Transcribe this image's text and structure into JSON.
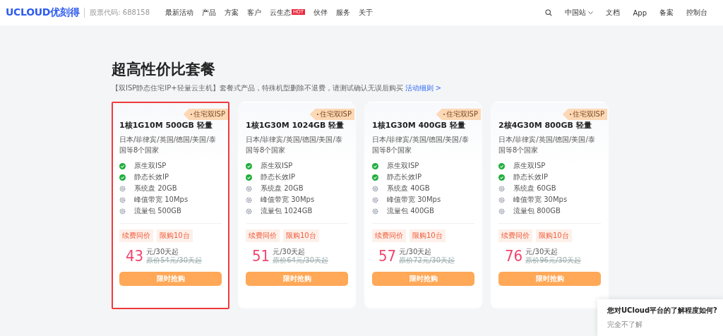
{
  "header": {
    "logo": "UCLOUD优刻得",
    "stock_code": "股票代码: 688158",
    "nav": [
      {
        "label": "最新活动"
      },
      {
        "label": "产品"
      },
      {
        "label": "方案"
      },
      {
        "label": "客户"
      },
      {
        "label": "云生态",
        "badge": "HOT"
      },
      {
        "label": "伙伴"
      },
      {
        "label": "服务"
      },
      {
        "label": "关于"
      }
    ],
    "region": "中国站",
    "links": [
      "文档",
      "App",
      "备案",
      "控制台"
    ]
  },
  "section": {
    "title": "超高性价比套餐",
    "subtitle": "【双ISP静态住宅IP+轻量云主机】套餐式产品，特殊机型删除不退费，请测试确认无误后购买",
    "link": "活动细则 >"
  },
  "plans": [
    {
      "selected": true,
      "badge": "住宅双ISP",
      "title": "1核1G10M 500GB 轻量",
      "description": "日本/菲律宾/英国/德国/美国/泰国等8个国家",
      "features": [
        {
          "kind": "check",
          "text": "原生双ISP"
        },
        {
          "kind": "check",
          "text": "静态长效IP"
        },
        {
          "kind": "gear",
          "text": "系统盘 20GB"
        },
        {
          "kind": "gear",
          "text": "峰值带宽 10Mps"
        },
        {
          "kind": "gear",
          "text": "流量包 500GB"
        }
      ],
      "tags": [
        "续费同价",
        "限购10台"
      ],
      "price": "43",
      "unit": "元/30天起",
      "original": "原价54元/30天起",
      "button": "限时抢购"
    },
    {
      "selected": false,
      "badge": "住宅双ISP",
      "title": "1核1G30M 1024GB 轻量",
      "description": "日本/菲律宾/英国/德国/美国/泰国等8个国家",
      "features": [
        {
          "kind": "check",
          "text": "原生双ISP"
        },
        {
          "kind": "check",
          "text": "静态长效IP"
        },
        {
          "kind": "gear",
          "text": "系统盘 20GB"
        },
        {
          "kind": "gear",
          "text": "峰值带宽 30Mps"
        },
        {
          "kind": "gear",
          "text": "流量包 1024GB"
        }
      ],
      "tags": [
        "续费同价",
        "限购10台"
      ],
      "price": "51",
      "unit": "元/30天起",
      "original": "原价64元/30天起",
      "button": "限时抢购"
    },
    {
      "selected": false,
      "badge": "住宅双ISP",
      "title": "1核1G30M 400GB 轻量",
      "description": "日本/菲律宾/英国/德国/美国/泰国等8个国家",
      "features": [
        {
          "kind": "check",
          "text": "原生双ISP"
        },
        {
          "kind": "check",
          "text": "静态长效IP"
        },
        {
          "kind": "gear",
          "text": "系统盘 40GB"
        },
        {
          "kind": "gear",
          "text": "峰值带宽 30Mps"
        },
        {
          "kind": "gear",
          "text": "流量包 400GB"
        }
      ],
      "tags": [
        "续费同价",
        "限购10台"
      ],
      "price": "57",
      "unit": "元/30天起",
      "original": "原价72元/30天起",
      "button": "限时抢购"
    },
    {
      "selected": false,
      "badge": "住宅双ISP",
      "title": "2核4G30M 800GB 轻量",
      "description": "日本/菲律宾/英国/德国/美国/泰国等8个国家",
      "features": [
        {
          "kind": "check",
          "text": "原生双ISP"
        },
        {
          "kind": "check",
          "text": "静态长效IP"
        },
        {
          "kind": "gear",
          "text": "系统盘 60GB"
        },
        {
          "kind": "gear",
          "text": "峰值带宽 30Mps"
        },
        {
          "kind": "gear",
          "text": "流量包 800GB"
        }
      ],
      "tags": [
        "续费同价",
        "限购10台"
      ],
      "price": "76",
      "unit": "元/30天起",
      "original": "原价96元/30天起",
      "button": "限时抢购"
    }
  ],
  "survey": {
    "title": "您对UCloud平台的了解程度如何?",
    "option": "完全不了解"
  }
}
